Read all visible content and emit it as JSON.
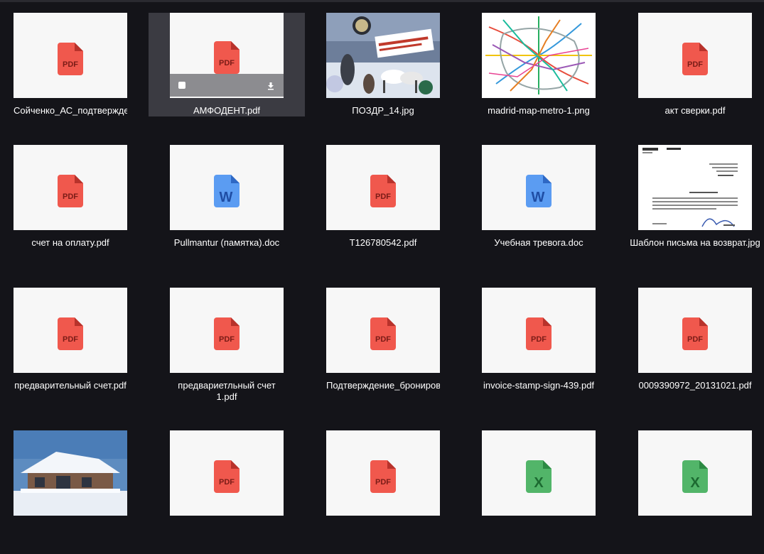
{
  "files": [
    {
      "name": "Сойченко_АС_подтвержде",
      "type": "pdf",
      "icon": "pdf-icon",
      "icon_label": "PDF"
    },
    {
      "name": "АМФОДЕНТ.pdf",
      "type": "pdf",
      "icon": "pdf-icon",
      "icon_label": "PDF",
      "selected": true
    },
    {
      "name": "ПОЗДР_14.jpg",
      "type": "image",
      "icon": "photo-thumbnail"
    },
    {
      "name": "madrid-map-metro-1.png",
      "type": "image",
      "icon": "map-thumbnail"
    },
    {
      "name": "акт сверки.pdf",
      "type": "pdf",
      "icon": "pdf-icon",
      "icon_label": "PDF"
    },
    {
      "name": "счет на оплату.pdf",
      "type": "pdf",
      "icon": "pdf-icon",
      "icon_label": "PDF"
    },
    {
      "name": "Pullmantur (памятка).doc",
      "type": "doc",
      "icon": "word-icon",
      "icon_label": "W"
    },
    {
      "name": "T126780542.pdf",
      "type": "pdf",
      "icon": "pdf-icon",
      "icon_label": "PDF"
    },
    {
      "name": "Учебная тревога.doc",
      "type": "doc",
      "icon": "word-icon",
      "icon_label": "W"
    },
    {
      "name": "Шаблон письма на возврат.jpg",
      "type": "image",
      "icon": "document-thumbnail"
    },
    {
      "name": "предварительный счет.pdf",
      "type": "pdf",
      "icon": "pdf-icon",
      "icon_label": "PDF"
    },
    {
      "name": "предвариетльный счет 1.pdf",
      "type": "pdf",
      "icon": "pdf-icon",
      "icon_label": "PDF"
    },
    {
      "name": "Подтверждение_бронирова",
      "type": "pdf",
      "icon": "pdf-icon",
      "icon_label": "PDF"
    },
    {
      "name": "invoice-stamp-sign-439.pdf",
      "type": "pdf",
      "icon": "pdf-icon",
      "icon_label": "PDF"
    },
    {
      "name": "0009390972_20131021.pdf",
      "type": "pdf",
      "icon": "pdf-icon",
      "icon_label": "PDF"
    },
    {
      "name": "",
      "type": "image",
      "icon": "house-photo-thumbnail"
    },
    {
      "name": "",
      "type": "pdf",
      "icon": "pdf-icon",
      "icon_label": "PDF"
    },
    {
      "name": "",
      "type": "pdf",
      "icon": "pdf-icon",
      "icon_label": "PDF"
    },
    {
      "name": "",
      "type": "xls",
      "icon": "excel-icon",
      "icon_label": "X"
    },
    {
      "name": "",
      "type": "xls",
      "icon": "excel-icon",
      "icon_label": "X"
    }
  ],
  "colors": {
    "background": "#141419",
    "pdf": "#f0584d",
    "word": "#5b9cf2",
    "excel": "#52b569",
    "selected_tile": "#3b3b42"
  }
}
